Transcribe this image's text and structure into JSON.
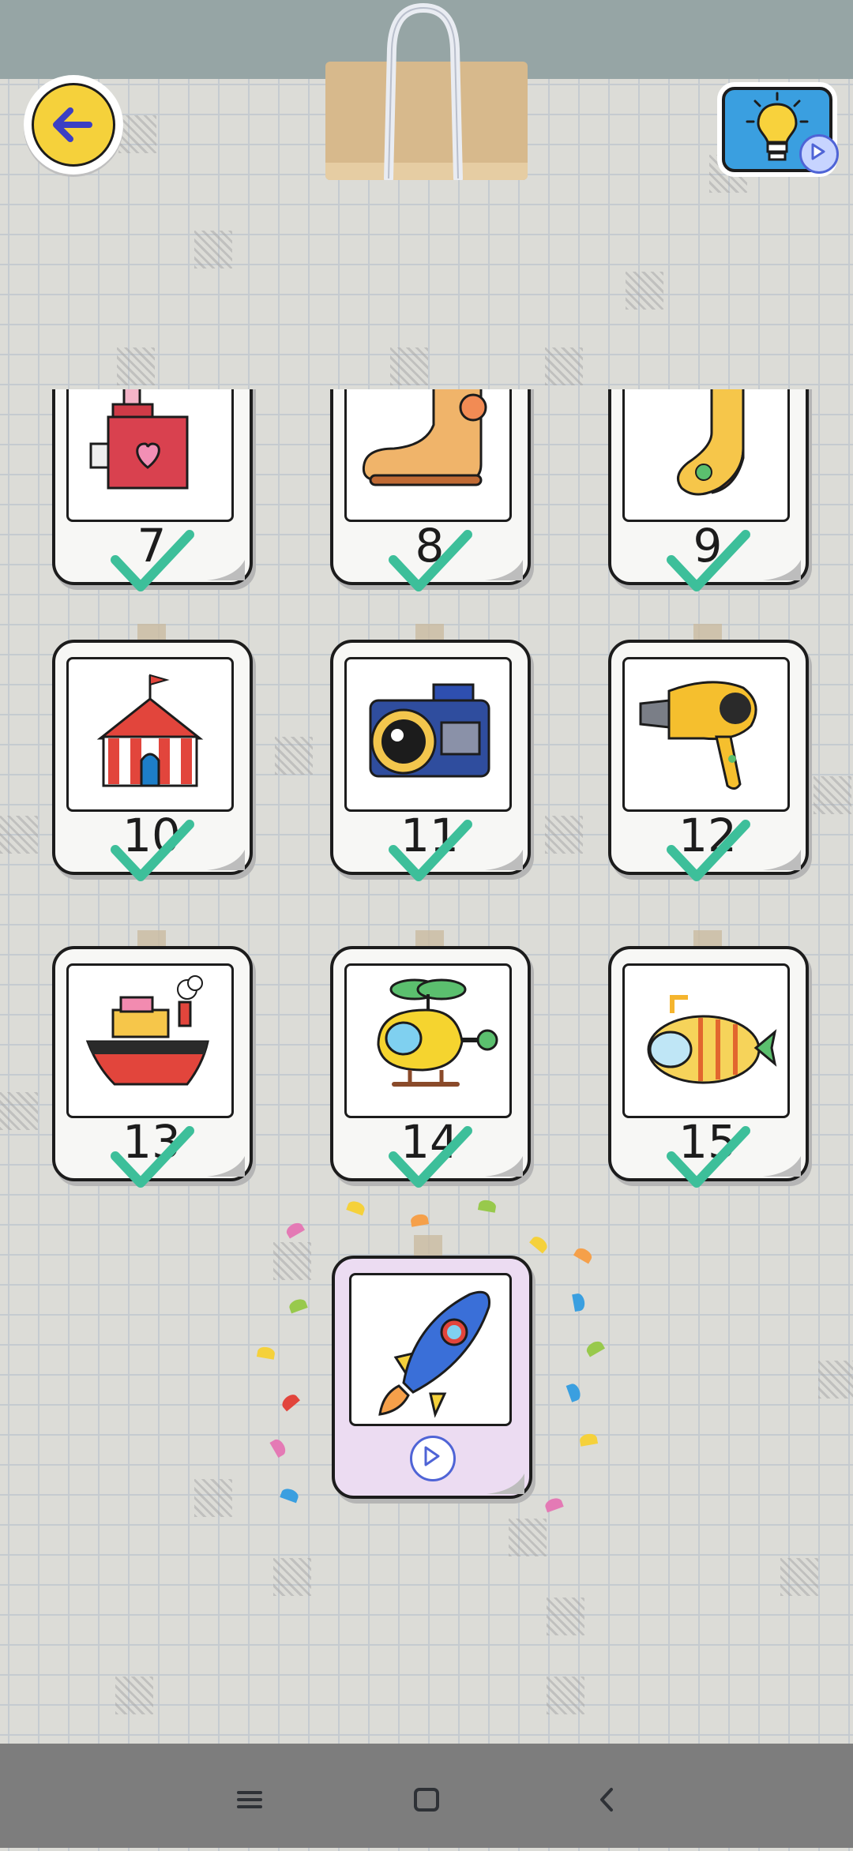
{
  "app": {
    "screen": "level-select"
  },
  "levels": [
    {
      "number": "7",
      "item": "music-box",
      "completed": true
    },
    {
      "number": "8",
      "item": "boot",
      "completed": true
    },
    {
      "number": "9",
      "item": "sock",
      "completed": true
    },
    {
      "number": "10",
      "item": "circus-tent",
      "completed": true
    },
    {
      "number": "11",
      "item": "camera",
      "completed": true
    },
    {
      "number": "12",
      "item": "hair-dryer",
      "completed": true
    },
    {
      "number": "13",
      "item": "ship",
      "completed": true
    },
    {
      "number": "14",
      "item": "helicopter",
      "completed": true
    },
    {
      "number": "15",
      "item": "submarine",
      "completed": true
    }
  ],
  "next_level": {
    "item": "rocket",
    "locked_by": "play-ad"
  },
  "buttons": {
    "back": "arrow-left-icon",
    "hint": "lightbulb-icon"
  },
  "colors": {
    "check": "#3dbf9a",
    "back": "#f5d13b",
    "hint": "#3a9fe0",
    "featured_card": "#ecdcf2"
  },
  "navigation": {
    "items": [
      "menu-icon",
      "home-icon",
      "back-nav-icon"
    ]
  }
}
